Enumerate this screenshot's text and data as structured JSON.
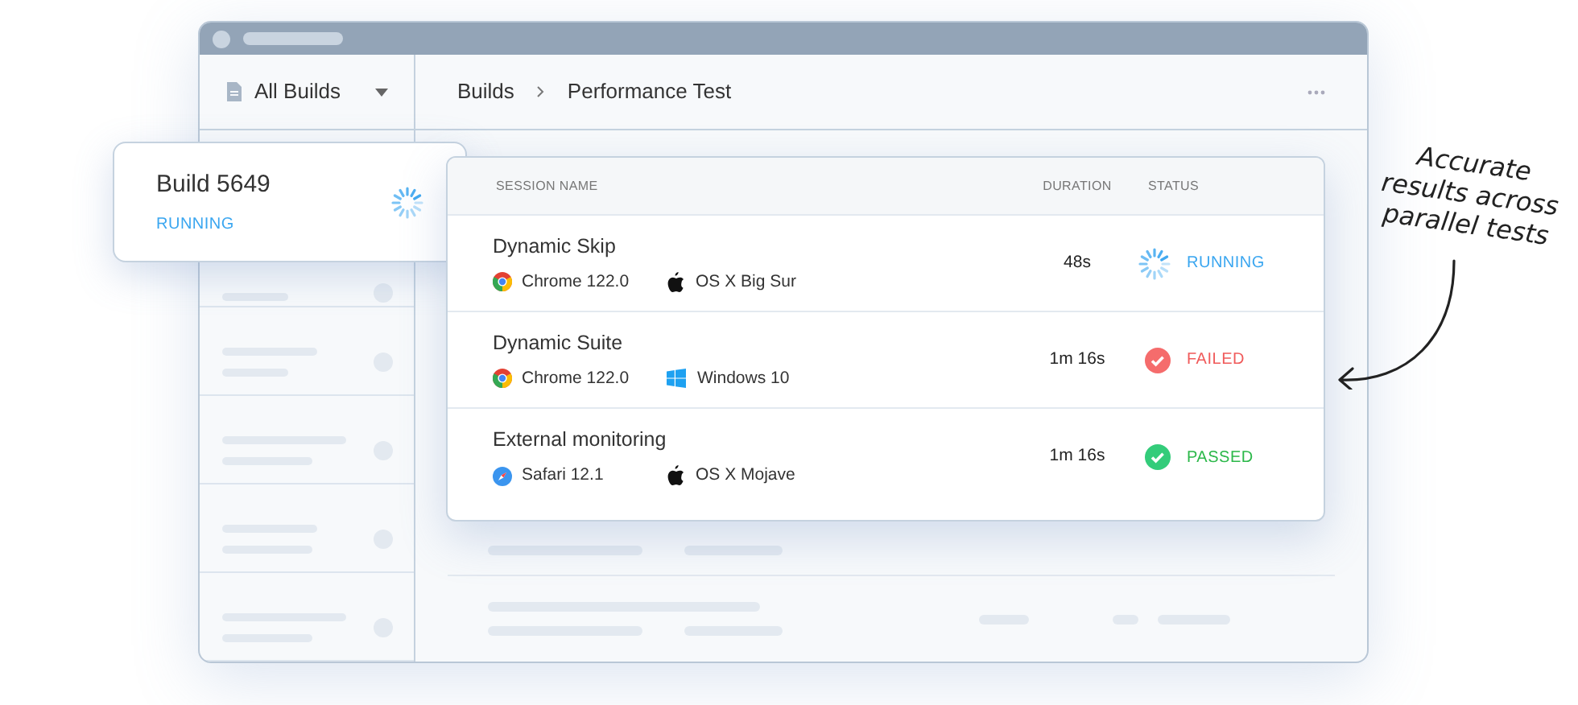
{
  "sidebar": {
    "title": "All Builds"
  },
  "breadcrumb": [
    "Builds",
    "Performance Test"
  ],
  "build_card": {
    "title": "Build 5649",
    "status": "RUNNING",
    "kind": "running"
  },
  "table": {
    "columns": [
      "SESSION NAME",
      "DURATION",
      "STATUS"
    ],
    "rows": [
      {
        "name": "Dynamic Skip",
        "browser": {
          "label": "Chrome 122.0",
          "kind": "chrome"
        },
        "os": {
          "label": "OS X Big Sur",
          "kind": "apple"
        },
        "duration": "48s",
        "status": "RUNNING",
        "kind": "running"
      },
      {
        "name": "Dynamic Suite",
        "browser": {
          "label": "Chrome 122.0",
          "kind": "chrome"
        },
        "os": {
          "label": "Windows 10",
          "kind": "windows"
        },
        "duration": "1m 16s",
        "status": "FAILED",
        "kind": "failed"
      },
      {
        "name": "External monitoring",
        "browser": {
          "label": "Safari 12.1",
          "kind": "safari"
        },
        "os": {
          "label": "OS X Mojave",
          "kind": "apple"
        },
        "duration": "1m 16s",
        "status": "PASSED",
        "kind": "passed"
      }
    ]
  },
  "annotation": "Accurate results across parallel tests"
}
